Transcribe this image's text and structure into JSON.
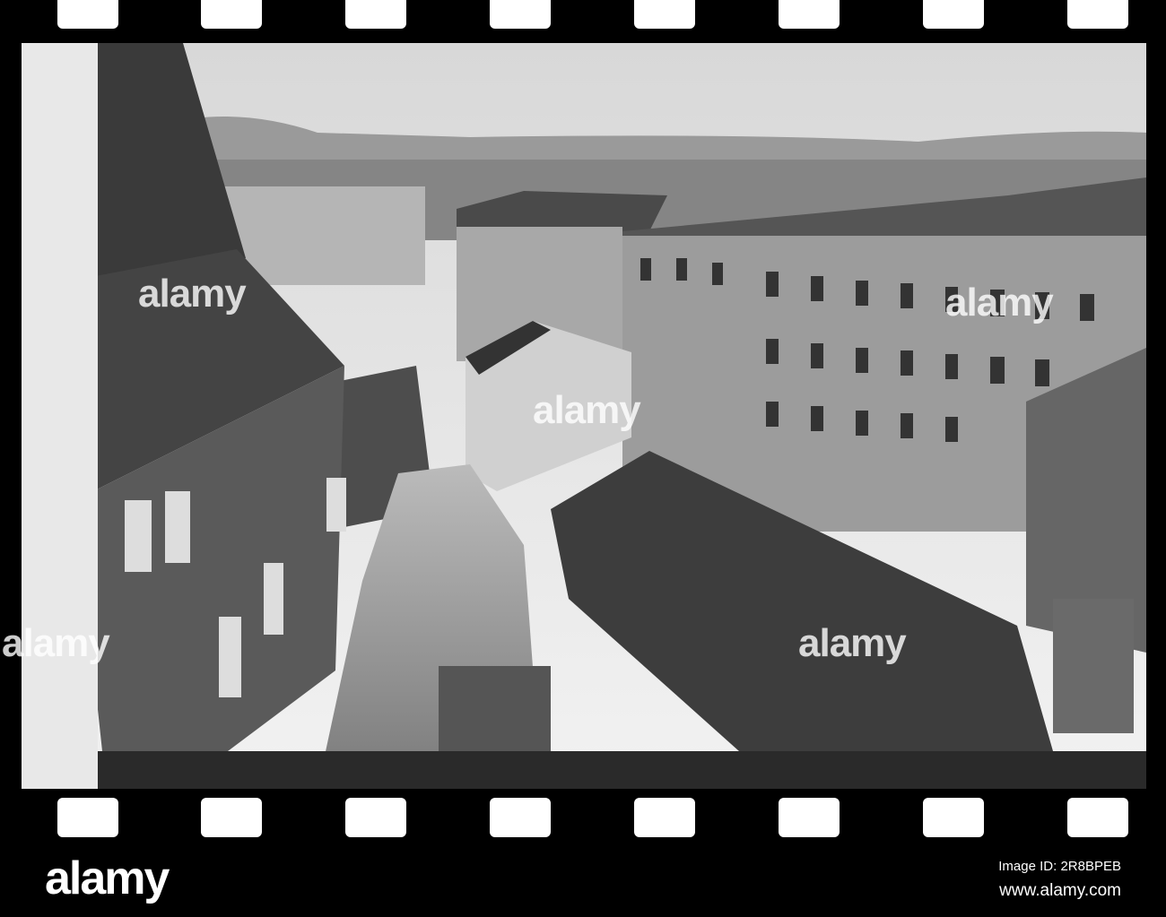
{
  "watermark": {
    "text": "alamy"
  },
  "footer": {
    "logo": "alamy",
    "image_id": "Image ID: 2R8BPEB",
    "url": "www.alamy.com"
  }
}
